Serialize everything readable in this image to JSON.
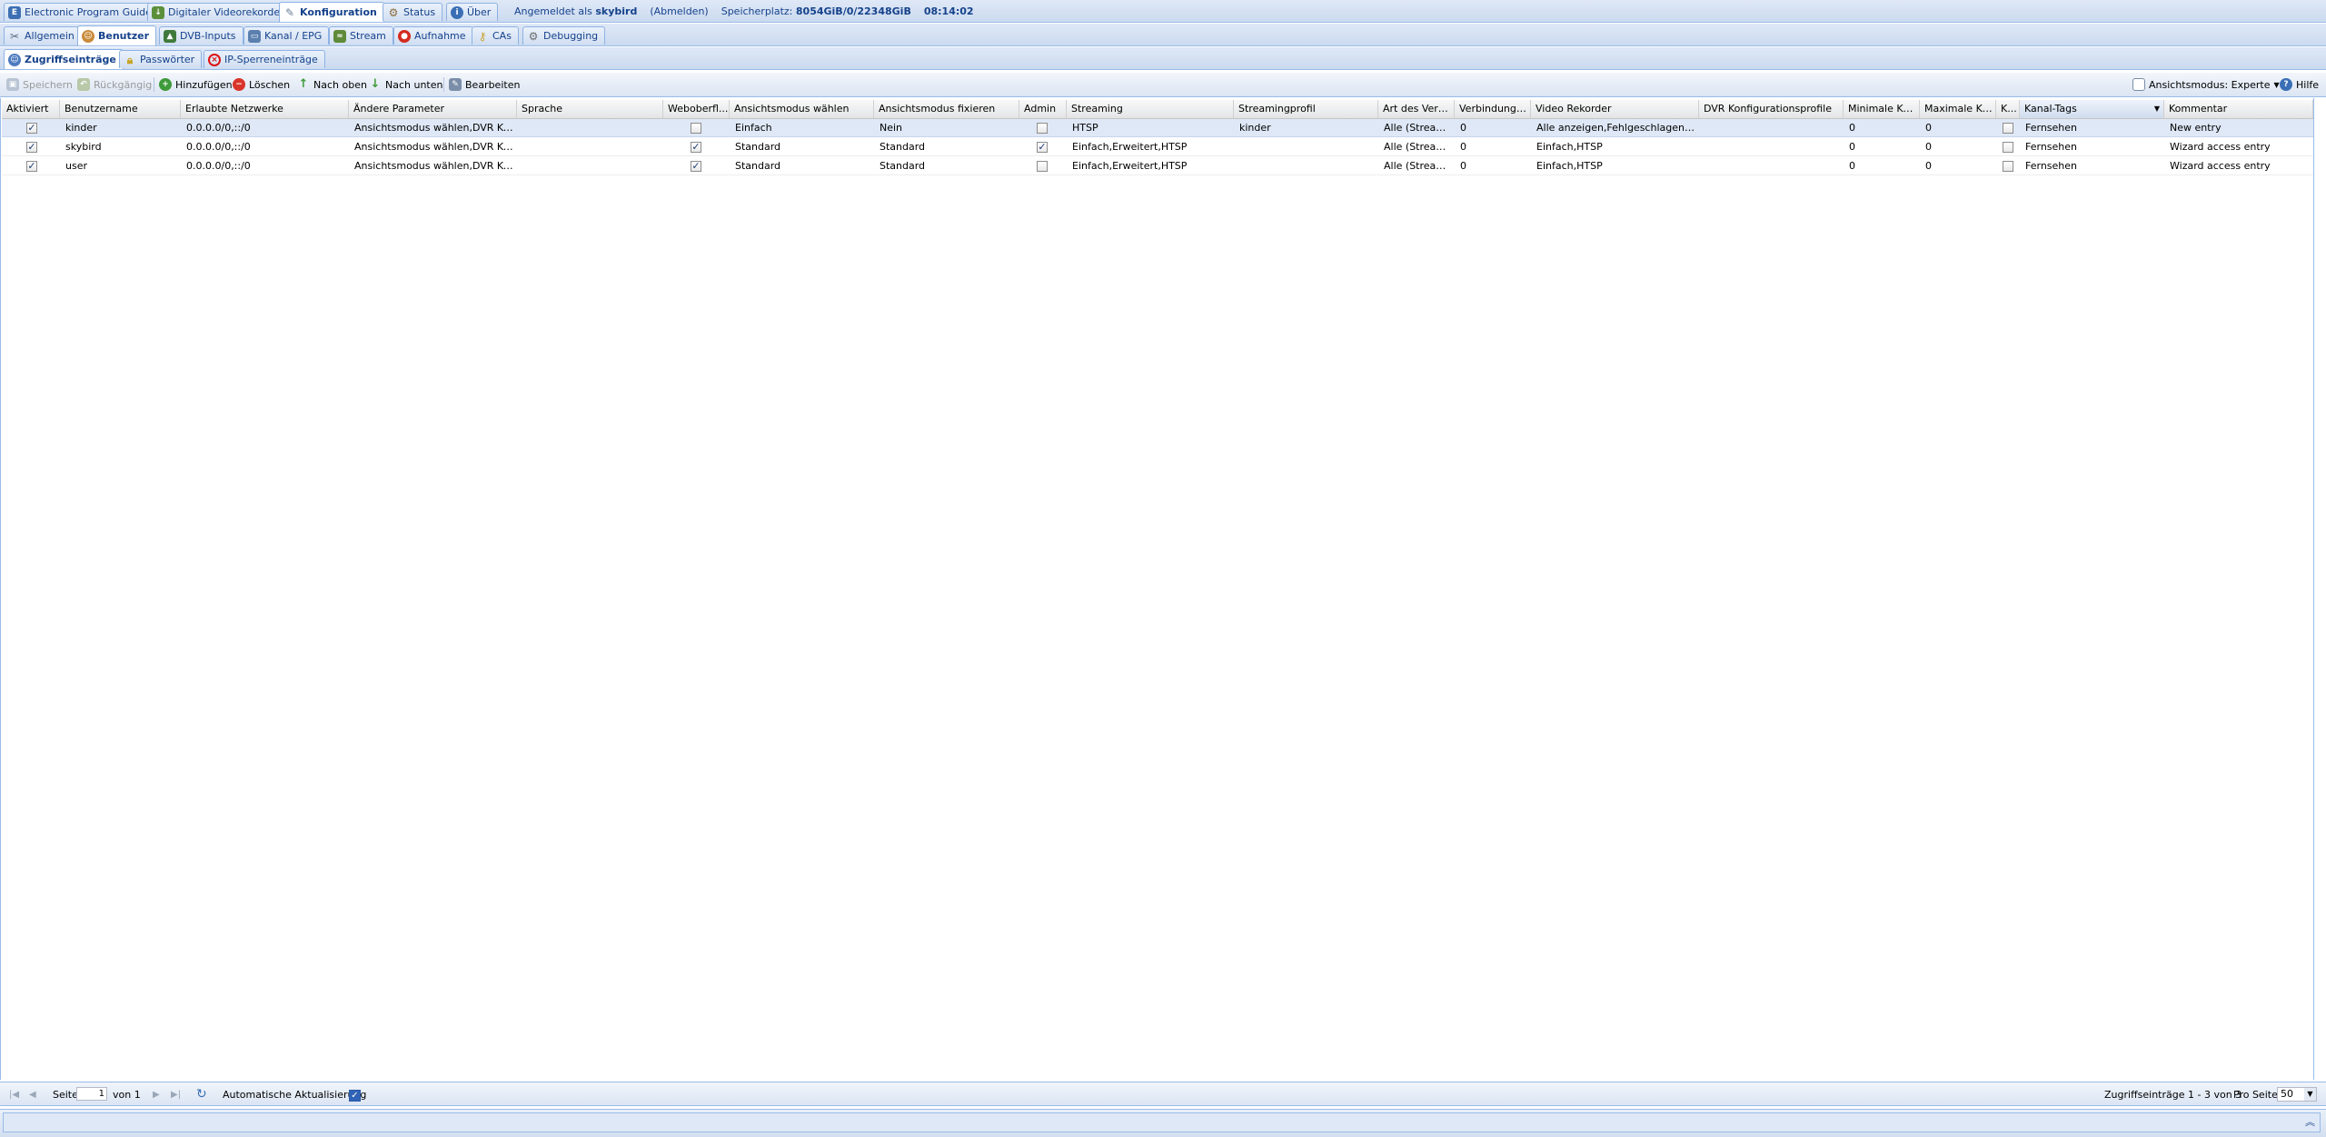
{
  "main_tabs": [
    {
      "label": "Electronic Program Guide",
      "icon": "epg-icon"
    },
    {
      "label": "Digitaler Videorekorder",
      "icon": "dvr-download-icon"
    },
    {
      "label": "Konfiguration",
      "icon": "wrench-icon"
    },
    {
      "label": "Status",
      "icon": "status-gear-icon"
    },
    {
      "label": "Über",
      "icon": "info-icon"
    }
  ],
  "header": {
    "logged_in_prefix": "Angemeldet als",
    "username": "skybird",
    "logout": "(Abmelden)",
    "storage_label": "Speicherplatz:",
    "storage_value": "8054GiB/0/22348GiB",
    "time": "08:14:02"
  },
  "config_tabs": [
    {
      "label": "Allgemein",
      "icon": "tools-icon"
    },
    {
      "label": "Benutzer",
      "icon": "users-icon"
    },
    {
      "label": "DVB-Inputs",
      "icon": "antenna-icon"
    },
    {
      "label": "Kanal / EPG",
      "icon": "tv-icon"
    },
    {
      "label": "Stream",
      "icon": "stream-icon"
    },
    {
      "label": "Aufnahme",
      "icon": "record-icon"
    },
    {
      "label": "CAs",
      "icon": "key-icon"
    },
    {
      "label": "Debugging",
      "icon": "bug-icon"
    }
  ],
  "user_tabs": [
    {
      "label": "Zugriffseinträge",
      "icon": "user-access-icon"
    },
    {
      "label": "Passwörter",
      "icon": "lock-icon"
    },
    {
      "label": "IP-Sperreneinträge",
      "icon": "block-icon"
    }
  ],
  "toolbar": {
    "save": "Speichern",
    "undo": "Rückgängig",
    "add": "Hinzufügen",
    "delete": "Löschen",
    "move_up": "Nach oben",
    "move_down": "Nach unten",
    "edit": "Bearbeiten",
    "view_mode": "Ansichtsmodus: Experte",
    "help": "Hilfe"
  },
  "columns": [
    "Aktiviert",
    "Benutzername",
    "Erlaubte Netzwerke",
    "Ändere Parameter",
    "Sprache",
    "Weboberfl...",
    "Ansichtsmodus wählen",
    "Ansichtsmodus fixieren",
    "Admin",
    "Streaming",
    "Streamingprofil",
    "Art des Verb...",
    "Verbindungs...",
    "Video Rekorder",
    "DVR Konfigurationsprofile",
    "Minimale Kan...",
    "Maximale Ka...",
    "K...",
    "Kanal-Tags",
    "Kommentar"
  ],
  "rows": [
    {
      "enabled": true,
      "username": "kinder",
      "networks": "0.0.0.0/0,::/0",
      "change": "Ansichtsmodus wählen,DVR Kon...",
      "language": "",
      "webui": false,
      "uilevel": "Einfach",
      "uilevel_nochange": "Nein",
      "admin": false,
      "streaming": "HTSP",
      "profile": "kinder",
      "conn_type": "Alle (Streami...",
      "conn_limit": "0",
      "dvr": "Alle anzeigen,Fehlgeschlagene Wi...",
      "dvr_config": "",
      "chmin": "0",
      "chmax": "0",
      "k": false,
      "tags": "Fernsehen",
      "comment": "New entry"
    },
    {
      "enabled": true,
      "username": "skybird",
      "networks": "0.0.0.0/0,::/0",
      "change": "Ansichtsmodus wählen,DVR Kon...",
      "language": "",
      "webui": true,
      "uilevel": "Standard",
      "uilevel_nochange": "Standard",
      "admin": true,
      "streaming": "Einfach,Erweitert,HTSP",
      "profile": "",
      "conn_type": "Alle (Streami...",
      "conn_limit": "0",
      "dvr": "Einfach,HTSP",
      "dvr_config": "",
      "chmin": "0",
      "chmax": "0",
      "k": false,
      "tags": "Fernsehen",
      "comment": "Wizard access entry"
    },
    {
      "enabled": true,
      "username": "user",
      "networks": "0.0.0.0/0,::/0",
      "change": "Ansichtsmodus wählen,DVR Kon...",
      "language": "",
      "webui": true,
      "uilevel": "Standard",
      "uilevel_nochange": "Standard",
      "admin": false,
      "streaming": "Einfach,Erweitert,HTSP",
      "profile": "",
      "conn_type": "Alle (Streami...",
      "conn_limit": "0",
      "dvr": "Einfach,HTSP",
      "dvr_config": "",
      "chmin": "0",
      "chmax": "0",
      "k": false,
      "tags": "Fernsehen",
      "comment": "Wizard access entry"
    }
  ],
  "pager": {
    "page_label": "Seite",
    "page_value": "1",
    "of_label": "von 1",
    "auto_refresh": "Automatische Aktualisierung",
    "auto_refresh_checked": true,
    "summary": "Zugriffseinträge 1 - 3 von 3",
    "per_page_label": "Pro Seite",
    "per_page_value": "50"
  },
  "colors": {
    "accent": "#15428b",
    "border": "#99bbe8",
    "selected_row": "#dfe8f6"
  }
}
